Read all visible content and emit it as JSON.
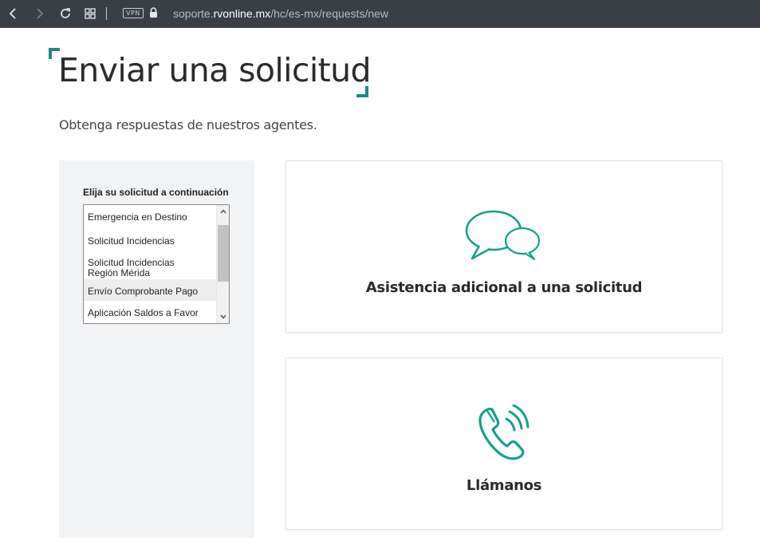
{
  "browser": {
    "vpn_label": "VPN",
    "url_prefix": "soporte.",
    "url_domain": "rvonline.mx",
    "url_path": "/hc/es-mx/requests/new"
  },
  "page": {
    "title": "Enviar una solicitud",
    "subtitle": "Obtenga respuestas de nuestros agentes."
  },
  "request_form": {
    "label": "Elija su solicitud a continuación",
    "options": [
      "Emergencia en Destino",
      "Solicitud Incidencias",
      "Solicitud Incidencias",
      "Región Mérida",
      "Envío Comprobante Pago",
      "Aplicación Saldos a Favor"
    ]
  },
  "cards": {
    "assist_label": "Asistencia adicional a una solicitud",
    "call_label": "Llámanos"
  },
  "colors": {
    "accent": "#1d8a84",
    "icon_teal": "#17a08f",
    "browser_bar": "#3a3f45",
    "panel_bg": "#f2f3f5"
  }
}
